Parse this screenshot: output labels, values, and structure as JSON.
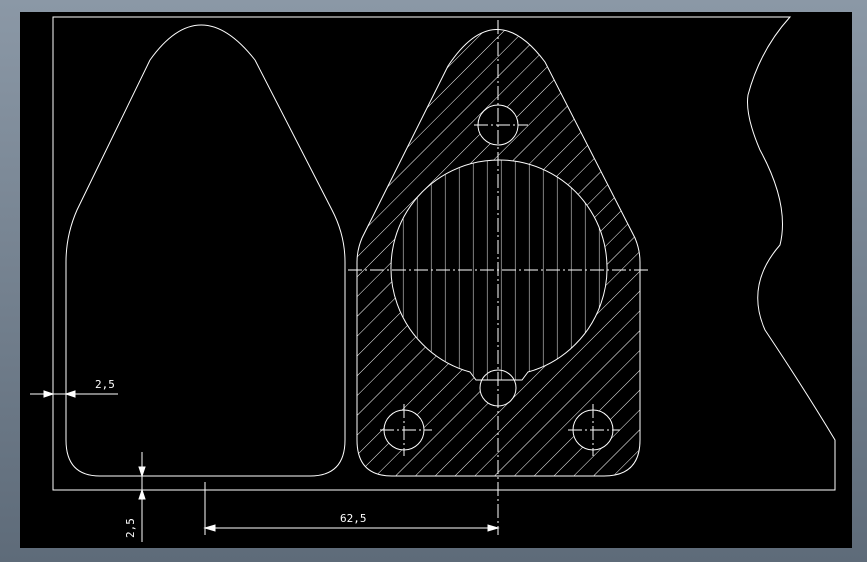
{
  "drawing": {
    "dimensions": {
      "gap_left": "2,5",
      "gap_bottom": "2,5",
      "center_offset": "62,5"
    },
    "colors": {
      "background": "#000000",
      "outer_frame": "#6f7d8c",
      "line": "#ffffff"
    }
  }
}
